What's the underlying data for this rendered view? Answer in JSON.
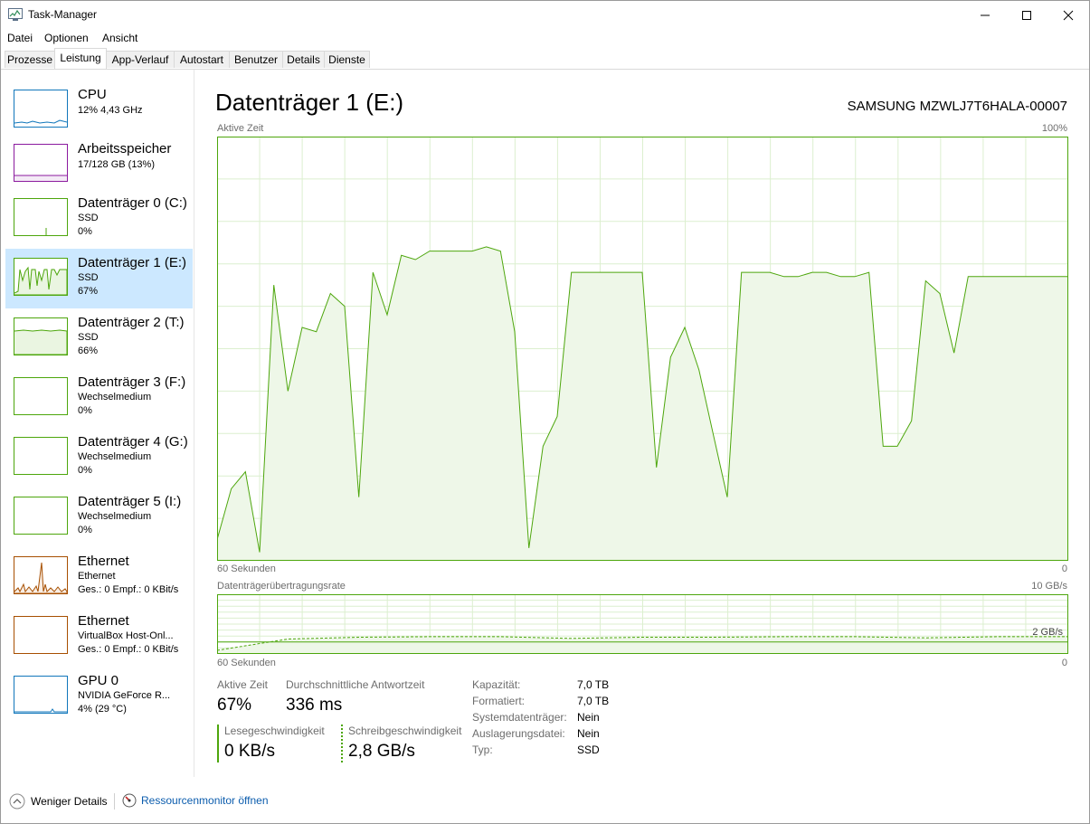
{
  "window": {
    "title": "Task-Manager"
  },
  "menu": [
    "Datei",
    "Optionen",
    "Ansicht"
  ],
  "tabs": [
    "Prozesse",
    "Leistung",
    "App-Verlauf",
    "Autostart",
    "Benutzer",
    "Details",
    "Dienste"
  ],
  "active_tab": "Leistung",
  "sidebar": [
    {
      "name": "CPU",
      "sub1": "12% 4,43 GHz",
      "sub2": "",
      "color": "#1177bb"
    },
    {
      "name": "Arbeitsspeicher",
      "sub1": "17/128 GB (13%)",
      "sub2": "",
      "color": "#8b1a9e"
    },
    {
      "name": "Datenträger 0 (C:)",
      "sub1": "SSD",
      "sub2": "0%",
      "color": "#4da60c"
    },
    {
      "name": "Datenträger 1 (E:)",
      "sub1": "SSD",
      "sub2": "67%",
      "color": "#4da60c"
    },
    {
      "name": "Datenträger 2 (T:)",
      "sub1": "SSD",
      "sub2": "66%",
      "color": "#4da60c"
    },
    {
      "name": "Datenträger 3 (F:)",
      "sub1": "Wechselmedium",
      "sub2": "0%",
      "color": "#4da60c"
    },
    {
      "name": "Datenträger 4 (G:)",
      "sub1": "Wechselmedium",
      "sub2": "0%",
      "color": "#4da60c"
    },
    {
      "name": "Datenträger 5 (I:)",
      "sub1": "Wechselmedium",
      "sub2": "0%",
      "color": "#4da60c"
    },
    {
      "name": "Ethernet",
      "sub1": "Ethernet",
      "sub2": "Ges.: 0 Empf.: 0 KBit/s",
      "color": "#a74f01"
    },
    {
      "name": "Ethernet",
      "sub1": "VirtualBox Host-Onl...",
      "sub2": "Ges.: 0 Empf.: 0 KBit/s",
      "color": "#a74f01"
    },
    {
      "name": "GPU 0",
      "sub1": "NVIDIA GeForce R...",
      "sub2": "4% (29 °C)",
      "color": "#1177bb"
    }
  ],
  "selected_index": 3,
  "main": {
    "title": "Datenträger 1 (E:)",
    "model": "SAMSUNG MZWLJ7T6HALA-00007",
    "chart1": {
      "label": "Aktive Zeit",
      "max": "100%",
      "xleft": "60 Sekunden",
      "xright": "0"
    },
    "chart2": {
      "label": "Datenträgerübertragungsrate",
      "max": "10 GB/s",
      "mid": "2 GB/s",
      "xleft": "60 Sekunden",
      "xright": "0"
    },
    "stats": {
      "active_label": "Aktive Zeit",
      "active_val": "67%",
      "resp_label": "Durchschnittliche Antwortzeit",
      "resp_val": "336 ms",
      "read_label": "Lesegeschwindigkeit",
      "read_val": "0 KB/s",
      "write_label": "Schreibgeschwindigkeit",
      "write_val": "2,8 GB/s"
    },
    "props": [
      {
        "k": "Kapazität:",
        "v": "7,0 TB"
      },
      {
        "k": "Formatiert:",
        "v": "7,0 TB"
      },
      {
        "k": "Systemdatenträger:",
        "v": "Nein"
      },
      {
        "k": "Auslagerungsdatei:",
        "v": "Nein"
      },
      {
        "k": "Typ:",
        "v": "SSD"
      }
    ]
  },
  "footer": {
    "less_details": "Weniger Details",
    "resmon": "Ressourcenmonitor öffnen"
  },
  "chart_data": [
    {
      "type": "area",
      "title": "Aktive Zeit",
      "x_unit": "seconds ago",
      "xlim": [
        60,
        0
      ],
      "ylim": [
        0,
        100
      ],
      "x": [
        60,
        59,
        58,
        57,
        56,
        55,
        54,
        53,
        52,
        51,
        50,
        49,
        48,
        47,
        46,
        45,
        44,
        43,
        42,
        41,
        40,
        39,
        38,
        37,
        36,
        35,
        34,
        33,
        32,
        31,
        30,
        29,
        28,
        27,
        26,
        25,
        24,
        23,
        22,
        21,
        20,
        19,
        18,
        17,
        16,
        15,
        14,
        13,
        12,
        11,
        10,
        9,
        8,
        7,
        6,
        5,
        4,
        3,
        2,
        1,
        0
      ],
      "values": [
        5,
        17,
        21,
        2,
        65,
        40,
        55,
        54,
        63,
        60,
        15,
        68,
        58,
        72,
        71,
        73,
        73,
        73,
        73,
        74,
        73,
        54,
        3,
        27,
        34,
        68,
        68,
        68,
        68,
        68,
        68,
        22,
        48,
        55,
        45,
        30,
        15,
        68,
        68,
        68,
        67,
        67,
        68,
        68,
        67,
        67,
        68,
        27,
        27,
        33,
        66,
        63,
        49,
        67,
        67,
        67,
        67,
        67,
        67,
        67,
        67
      ]
    },
    {
      "type": "line",
      "title": "Datenträgerübertragungsrate",
      "ylim": [
        0,
        10
      ],
      "y_unit": "GB/s",
      "x": [
        60,
        55,
        50,
        45,
        40,
        35,
        30,
        25,
        20,
        15,
        10,
        5,
        0
      ],
      "series": [
        {
          "values": [
            0.6,
            2.5,
            2.8,
            2.9,
            2.9,
            2.6,
            2.8,
            2.8,
            2.9,
            2.9,
            2.7,
            2.9,
            2.9
          ]
        },
        {
          "values": [
            2.0,
            2.0,
            2.0,
            2.0,
            2.0,
            2.0,
            2.0,
            2.0,
            2.0,
            2.0,
            2.0,
            2.0,
            2.0
          ]
        }
      ]
    }
  ]
}
